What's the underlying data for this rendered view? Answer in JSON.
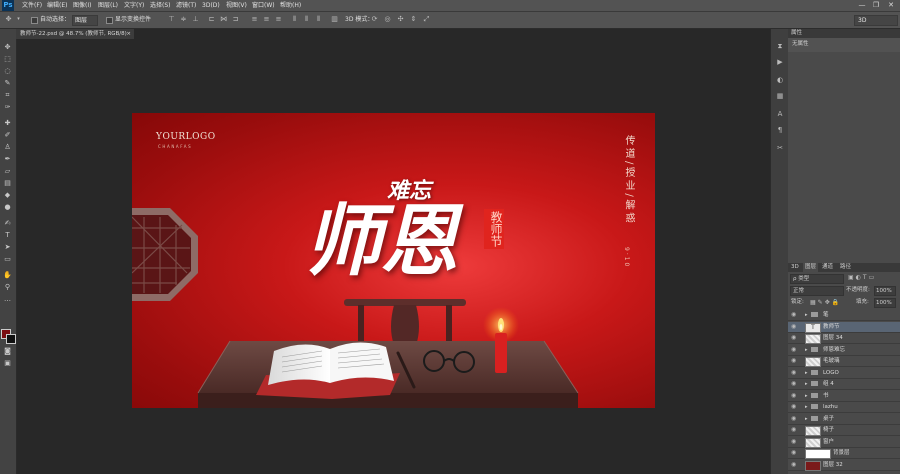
{
  "app": {
    "logo": "Ps"
  },
  "menu": [
    "文件(F)",
    "编辑(E)",
    "图像(I)",
    "图层(L)",
    "文字(Y)",
    "选择(S)",
    "滤镜(T)",
    "3D(D)",
    "视图(V)",
    "窗口(W)",
    "帮助(H)"
  ],
  "window_controls": {
    "minimize": "—",
    "restore": "❐",
    "close": "✕"
  },
  "options_bar": {
    "auto_select_label": "自动选择：",
    "auto_select_value": "图层",
    "show_transform_label": "显示变换控件",
    "mode_label": "3D 模式：",
    "workspace_value": "3D"
  },
  "document_tab": {
    "title": "教师节-22.psd @ 48.7% (教师节, RGB/8)",
    "close": "×"
  },
  "canvas": {
    "logo_main": "YOURLOGO",
    "logo_sub": "CHANAFAS",
    "title_small": "难忘",
    "title_large": "师恩",
    "seal_text": "教师节",
    "side_text": "传道/授业/解惑",
    "side_date": "9·10"
  },
  "properties_panel": {
    "tab": "属性",
    "body": "无属性"
  },
  "layers_panel": {
    "tabs": [
      "3D",
      "图层",
      "通道",
      "路径"
    ],
    "filter_label": "ρ 类型",
    "blend_mode": "正常",
    "opacity_label": "不透明度:",
    "opacity_value": "100%",
    "lock_label": "锁定:",
    "fill_label": "填充:",
    "fill_value": "100%",
    "layers": [
      {
        "name": "笔",
        "kind": "folder",
        "selected": false
      },
      {
        "name": "教师节",
        "kind": "text",
        "selected": true
      },
      {
        "name": "图层 34",
        "kind": "pixel",
        "selected": false
      },
      {
        "name": "师恩难忘",
        "kind": "folder",
        "selected": false
      },
      {
        "name": "毛玻璃",
        "kind": "pixel",
        "selected": false
      },
      {
        "name": "LOGO",
        "kind": "folder",
        "selected": false
      },
      {
        "name": "组 4",
        "kind": "folder",
        "selected": false
      },
      {
        "name": "书",
        "kind": "folder",
        "selected": false
      },
      {
        "name": "lazhu",
        "kind": "folder",
        "selected": false
      },
      {
        "name": "桌子",
        "kind": "folder",
        "selected": false
      },
      {
        "name": "椅子",
        "kind": "pixel",
        "selected": false
      },
      {
        "name": "窗户",
        "kind": "pixel",
        "selected": false
      },
      {
        "name": "背景层",
        "kind": "masked",
        "selected": false
      },
      {
        "name": "图层 32",
        "kind": "colorfill",
        "selected": false
      }
    ]
  },
  "colors": {
    "foreground": "#7a0c10",
    "background": "#111111",
    "canvas_red": "#c81818",
    "ui_dark": "#282828"
  }
}
